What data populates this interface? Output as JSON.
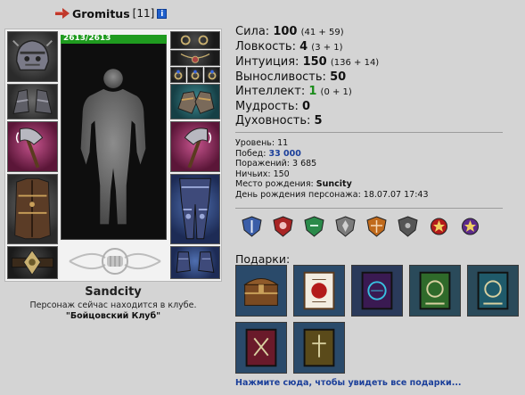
{
  "header": {
    "name": "Gromitus",
    "level": "[11]",
    "info_label": "i"
  },
  "character": {
    "hp": "2613/2613",
    "hp_fraction": 1.0,
    "hp_color": "#1f9b1f"
  },
  "location": {
    "city": "Sandcity",
    "status": "Персонаж сейчас находится в клубе.",
    "club": "\"Бойцовский Клуб\""
  },
  "stats": [
    {
      "label": "Сила:",
      "value": "100",
      "detail": "(41 + 59)"
    },
    {
      "label": "Ловкость:",
      "value": "4",
      "detail": "(3 + 1)"
    },
    {
      "label": "Интуиция:",
      "value": "150",
      "detail": "(136 + 14)"
    },
    {
      "label": "Выносливость:",
      "value": "50",
      "detail": ""
    },
    {
      "label": "Интеллект:",
      "value": "1",
      "detail": "(0 + 1)",
      "highlight": true
    },
    {
      "label": "Мудрость:",
      "value": "0",
      "detail": ""
    },
    {
      "label": "Духовность:",
      "value": "5",
      "detail": ""
    }
  ],
  "info": {
    "level_label": "Уровень:",
    "level_value": "11",
    "wins_label": "Побед:",
    "wins_value": "33 000",
    "losses_label": "Поражений:",
    "losses_value": "3 685",
    "draws_label": "Ничьих:",
    "draws_value": "150",
    "birthplace_label": "Место рождения:",
    "birthplace_value": "Suncity",
    "birthday_label": "День рождения персонажа:",
    "birthday_value": "18.07.07 17:43"
  },
  "badges": [
    "shield-blue",
    "shield-red",
    "shield-green",
    "shield-gray",
    "shield-orange",
    "shield-dark",
    "medal-red",
    "medal-purple"
  ],
  "gifts": {
    "title": "Подарки:",
    "items": [
      "chest-gift",
      "book-white",
      "book-purple",
      "book-green",
      "book-teal",
      "book-maroon",
      "book-olive"
    ],
    "more_link": "Нажмите сюда, чтобы увидеть все подарки..."
  },
  "colors": {
    "background": "#d4d4d4",
    "link": "#1b3f9a",
    "highlight": "#1a8c1a"
  }
}
